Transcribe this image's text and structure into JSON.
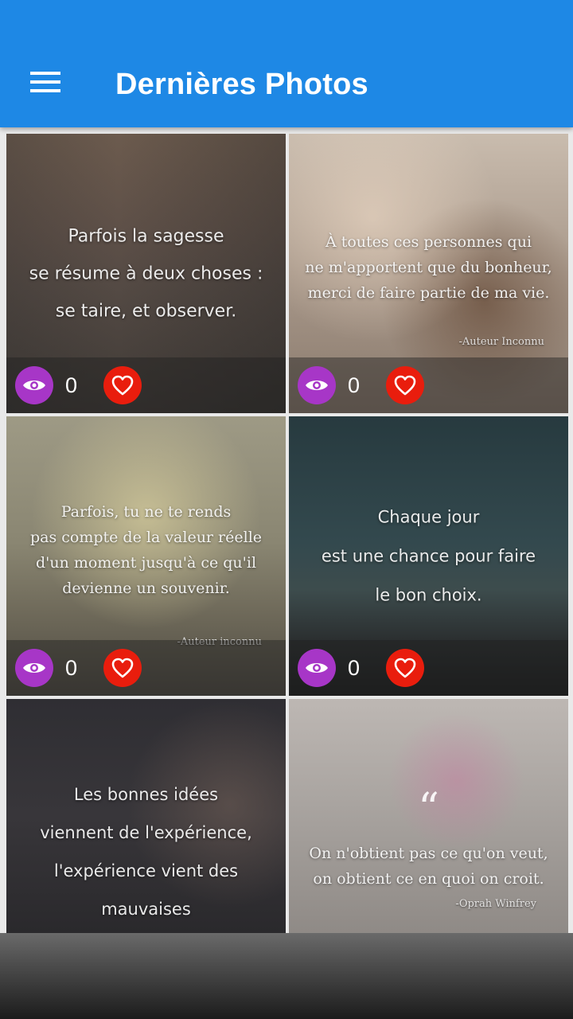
{
  "app_bar": {
    "title": "Dernières Photos",
    "menu_icon": "hamburger-menu-icon",
    "color": "#1e88e5"
  },
  "photos": [
    {
      "lines": "Parfois la sagesse\nse résume à deux choses :\nse taire, et observer.",
      "author": "",
      "views": "0"
    },
    {
      "lines": "À toutes ces personnes qui\nne m'apportent que du bonheur,\nmerci de faire partie de ma vie.",
      "author": "-Auteur Inconnu",
      "views": "0"
    },
    {
      "lines": "Parfois, tu ne te rends\npas compte de la valeur réelle\nd'un moment jusqu'à ce qu'il\ndevienne un souvenir.",
      "author": "-Auteur inconnu",
      "views": "0"
    },
    {
      "lines": "Chaque jour\nest une chance pour faire\nle bon choix.",
      "author": "",
      "views": "0"
    },
    {
      "lines": "Les bonnes idées\nviennent de l'expérience,\nl'expérience vient des mauvaises\nidées",
      "author": "",
      "views": ""
    },
    {
      "lines": "On n'obtient pas ce qu'on veut,\non obtient ce en quoi on croit.",
      "author": "-Oprah Winfrey",
      "views": "",
      "quote_mark": "“"
    }
  ],
  "icons": {
    "views": "eye-icon",
    "like": "heart-icon"
  },
  "colors": {
    "views_button": "#a736c7",
    "like_button": "#e91d0d"
  }
}
